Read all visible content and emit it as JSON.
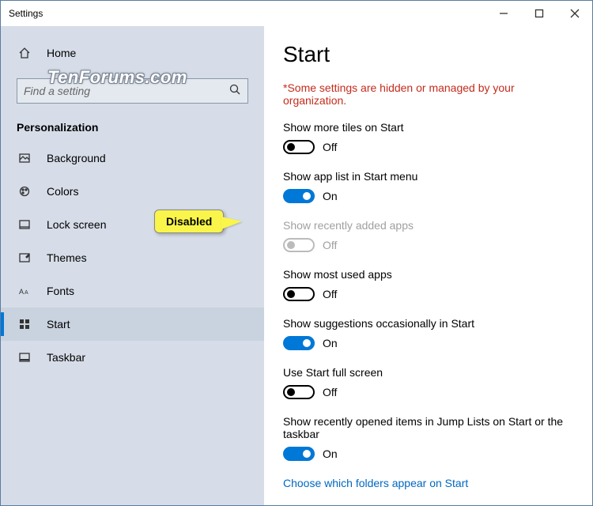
{
  "window": {
    "title": "Settings"
  },
  "watermark": "TenForums.com",
  "callout": {
    "text": "Disabled"
  },
  "sidebar": {
    "home": "Home",
    "search_placeholder": "Find a setting",
    "section": "Personalization",
    "items": [
      {
        "label": "Background",
        "active": false,
        "icon": "background"
      },
      {
        "label": "Colors",
        "active": false,
        "icon": "colors"
      },
      {
        "label": "Lock screen",
        "active": false,
        "icon": "lockscreen"
      },
      {
        "label": "Themes",
        "active": false,
        "icon": "themes"
      },
      {
        "label": "Fonts",
        "active": false,
        "icon": "fonts"
      },
      {
        "label": "Start",
        "active": true,
        "icon": "start"
      },
      {
        "label": "Taskbar",
        "active": false,
        "icon": "taskbar"
      }
    ]
  },
  "content": {
    "heading": "Start",
    "warning": "*Some settings are hidden or managed by your organization.",
    "settings": [
      {
        "label": "Show more tiles on Start",
        "on": false,
        "state": "Off",
        "disabled": false
      },
      {
        "label": "Show app list in Start menu",
        "on": true,
        "state": "On",
        "disabled": false
      },
      {
        "label": "Show recently added apps",
        "on": false,
        "state": "Off",
        "disabled": true
      },
      {
        "label": "Show most used apps",
        "on": false,
        "state": "Off",
        "disabled": false
      },
      {
        "label": "Show suggestions occasionally in Start",
        "on": true,
        "state": "On",
        "disabled": false
      },
      {
        "label": "Use Start full screen",
        "on": false,
        "state": "Off",
        "disabled": false
      },
      {
        "label": "Show recently opened items in Jump Lists on Start or the taskbar",
        "on": true,
        "state": "On",
        "disabled": false
      }
    ],
    "footer_link": "Choose which folders appear on Start"
  }
}
